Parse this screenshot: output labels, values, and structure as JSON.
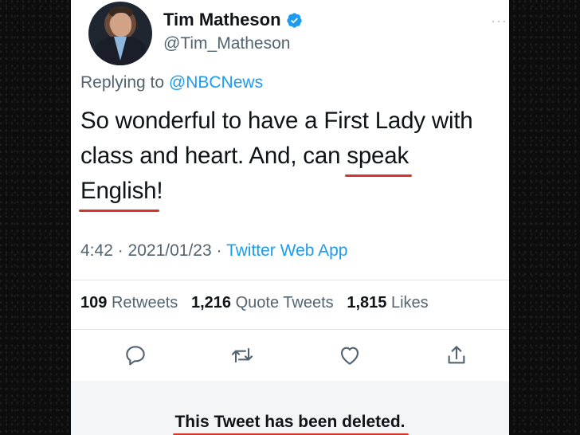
{
  "author": {
    "name": "Tim Matheson",
    "handle": "@Tim_Matheson",
    "verified": true
  },
  "more_label": "···",
  "replying": {
    "prefix": "Replying to ",
    "mention": "@NBCNews"
  },
  "tweet": {
    "part1": "So wonderful to have a First Lady with class and heart.  And, can ",
    "underlined1": "speak",
    "part2": " ",
    "underlined2": "English",
    "part3": "!"
  },
  "meta": {
    "time": "4:42",
    "sep1": " · ",
    "date": "2021/01/23",
    "sep2": " · ",
    "app": "Twitter Web App"
  },
  "stats": {
    "retweets_count": "109",
    "retweets_label": "Retweets",
    "quotes_count": "1,216",
    "quotes_label": "Quote Tweets",
    "likes_count": "1,815",
    "likes_label": "Likes"
  },
  "actions": [
    "reply-icon",
    "retweet-icon",
    "like-icon",
    "share-icon"
  ],
  "deleted_notice": "This Tweet has been deleted.",
  "colors": {
    "accent": "#1d9bf0",
    "text": "#0f1419",
    "secondary": "#536471",
    "underline": "#d8332b"
  }
}
